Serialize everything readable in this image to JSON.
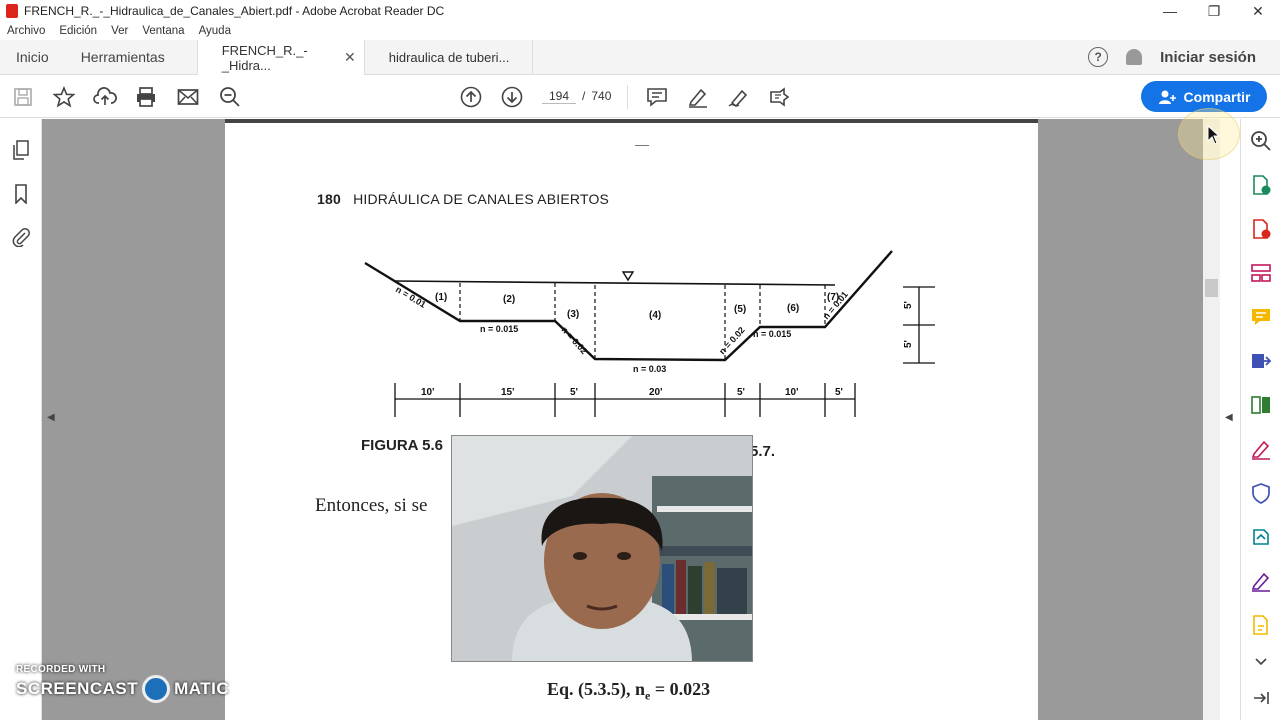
{
  "window": {
    "title": "FRENCH_R._-_Hidraulica_de_Canales_Abiert.pdf - Adobe Acrobat Reader DC",
    "minimize": "—",
    "restore": "❐",
    "close": "✕"
  },
  "menu": [
    "Archivo",
    "Edición",
    "Ver",
    "Ventana",
    "Ayuda"
  ],
  "tabs": {
    "home": "Inicio",
    "tools": "Herramientas",
    "documents": [
      {
        "label": "FRENCH_R._-_Hidra...",
        "close": "✕",
        "active": true
      },
      {
        "label": "hidraulica de tuberi...",
        "active": false
      }
    ],
    "signin": "Iniciar sesión"
  },
  "toolbar": {
    "page_current": "194",
    "page_sep": "/",
    "page_total": "740",
    "share_label": "Compartir"
  },
  "document": {
    "page_number": "180",
    "page_header": "HIDRÁULICA DE CANALES ABIERTOS",
    "figure": {
      "sections": [
        "(1)",
        "(2)",
        "(3)",
        "(4)",
        "(5)",
        "(6)",
        "(7)"
      ],
      "roughness_labels": [
        "n = 0.01",
        "n = 0.015",
        "n = 0.02",
        "n = 0.03",
        "n = 0.02",
        "n = 0.015",
        "n = 0.01"
      ],
      "widths": [
        "10'",
        "15'",
        "5'",
        "20'",
        "5'",
        "10'",
        "5'"
      ],
      "depths": [
        "5'",
        "5'"
      ]
    },
    "figure_caption": "FIGURA 5.6",
    "figure_caption_tail": "5.7.",
    "body_text": "Entonces, si se",
    "equation": "Eq. (5.3.5), n",
    "equation_sub": "e",
    "equation_value": " = 0.023"
  },
  "watermark": {
    "line1": "RECORDED WITH",
    "line2a": "SCREENCAST",
    "line2b": "MATIC"
  },
  "colors": {
    "accent": "#1473e6",
    "viewer_bg": "#9a9a9a"
  }
}
